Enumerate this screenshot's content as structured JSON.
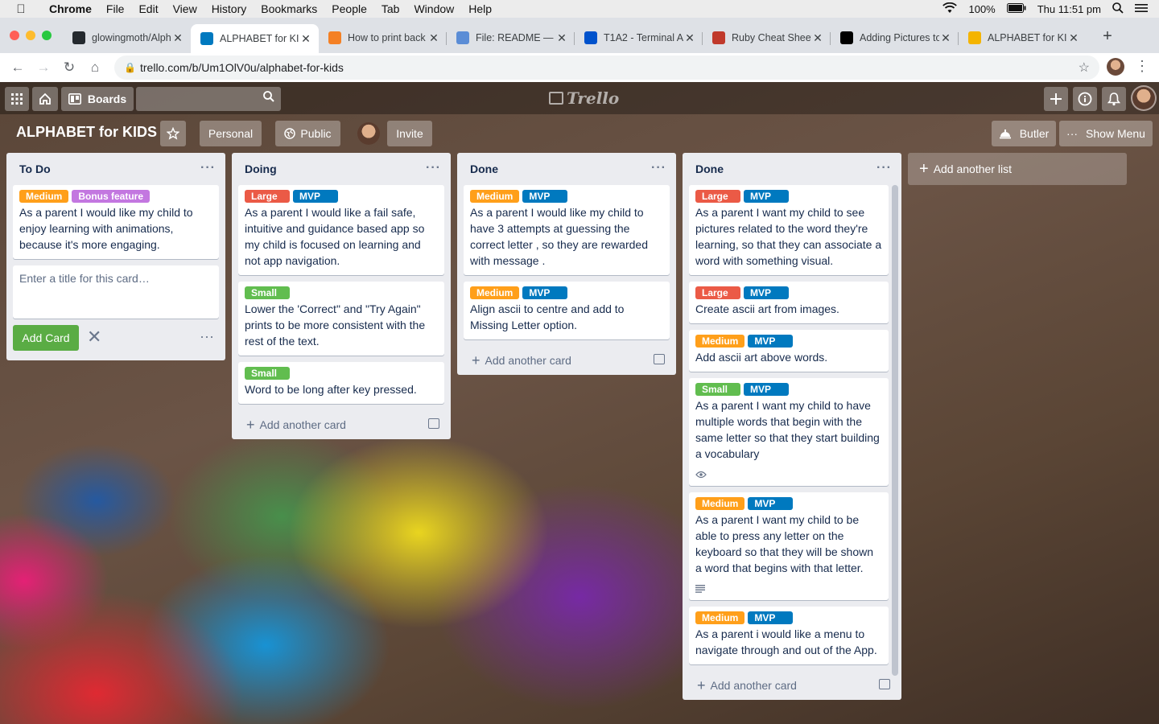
{
  "menubar": {
    "apple": "",
    "app": "Chrome",
    "items": [
      "File",
      "Edit",
      "View",
      "History",
      "Bookmarks",
      "People",
      "Tab",
      "Window",
      "Help"
    ],
    "battery": "100%",
    "clock": "Thu 11:51 pm"
  },
  "tabs": [
    {
      "title": "glowingmoth/Alph",
      "icon": "github-icon",
      "color": "#24292e"
    },
    {
      "title": "ALPHABET for KIDS",
      "icon": "trello-icon",
      "color": "#0079bf"
    },
    {
      "title": "How to print back",
      "icon": "stackoverflow-icon",
      "color": "#f48024"
    },
    {
      "title": "File: README — D",
      "icon": "document-icon",
      "color": "#5b8dd6"
    },
    {
      "title": "T1A2 - Terminal A",
      "icon": "atlassian-icon",
      "color": "#0052cc"
    },
    {
      "title": "Ruby Cheat Sheet",
      "icon": "cheatsheet-icon",
      "color": "#c0392b"
    },
    {
      "title": "Adding Pictures to",
      "icon": "medium-icon",
      "color": "#000000"
    },
    {
      "title": "ALPHABET for KIDS",
      "icon": "slides-icon",
      "color": "#f4b400"
    }
  ],
  "address": {
    "url": "trello.com/b/Um1OlV0u/alphabet-for-kids"
  },
  "header": {
    "boards_label": "Boards",
    "logo_text": "Trello"
  },
  "board": {
    "title": "ALPHABET for KIDS",
    "personal_label": "Personal",
    "public_label": "Public",
    "invite_label": "Invite",
    "butler_label": "Butler",
    "show_menu_label": "Show Menu",
    "add_list_label": "Add another list"
  },
  "labels_colors": {
    "Medium": "#ff9f1a",
    "Bonus feature": "#c377e0",
    "Large": "#eb5a46",
    "MVP": "#0079bf",
    "Small": "#61bd4f"
  },
  "lists": [
    {
      "title": "To Do",
      "cards": [
        {
          "labels": [
            "Medium",
            "Bonus feature"
          ],
          "text": "As a parent I would like my child to enjoy learning with animations, because it's more engaging."
        }
      ],
      "composer": {
        "placeholder": "Enter a title for this card…",
        "add_label": "Add Card"
      }
    },
    {
      "title": "Doing",
      "cards": [
        {
          "labels": [
            "Large",
            "MVP"
          ],
          "text": "As a parent I would like a fail safe, intuitive and guidance based app so my child is focused on learning and not app navigation."
        },
        {
          "labels": [
            "Small"
          ],
          "text": "Lower the 'Correct\" and \"Try Again\" prints to be more consistent with the rest of the text."
        },
        {
          "labels": [
            "Small"
          ],
          "text": "Word to be long after key pressed."
        }
      ],
      "add_card_label": "Add another card"
    },
    {
      "title": "Done",
      "cards": [
        {
          "labels": [
            "Medium",
            "MVP"
          ],
          "text": "As a parent I would like my child to have 3 attempts at guessing the correct letter , so they are rewarded with message ."
        },
        {
          "labels": [
            "Medium",
            "MVP"
          ],
          "text": "Align ascii to centre and add to Missing Letter option."
        }
      ],
      "add_card_label": "Add another card"
    },
    {
      "title": "Done",
      "cards": [
        {
          "labels": [
            "Large",
            "MVP"
          ],
          "text": "As a parent I want my child to see pictures related to the word they're learning, so that they can associate a word with something visual."
        },
        {
          "labels": [
            "Large",
            "MVP"
          ],
          "text": "Create ascii art from images."
        },
        {
          "labels": [
            "Medium",
            "MVP"
          ],
          "text": "Add ascii art above words."
        },
        {
          "labels": [
            "Small",
            "MVP"
          ],
          "text": "As a parent I want my child to have multiple words that begin with the same letter so that they start building a vocabulary",
          "badge": "eye-icon"
        },
        {
          "labels": [
            "Medium",
            "MVP"
          ],
          "text": "As a parent I want my child to be able to press any letter on the keyboard so that they will be shown a word that begins with that letter.",
          "badge": "description-icon"
        },
        {
          "labels": [
            "Medium",
            "MVP"
          ],
          "text": "As a parent i would like a menu to navigate through and out of the App."
        }
      ],
      "add_card_label": "Add another card"
    }
  ]
}
